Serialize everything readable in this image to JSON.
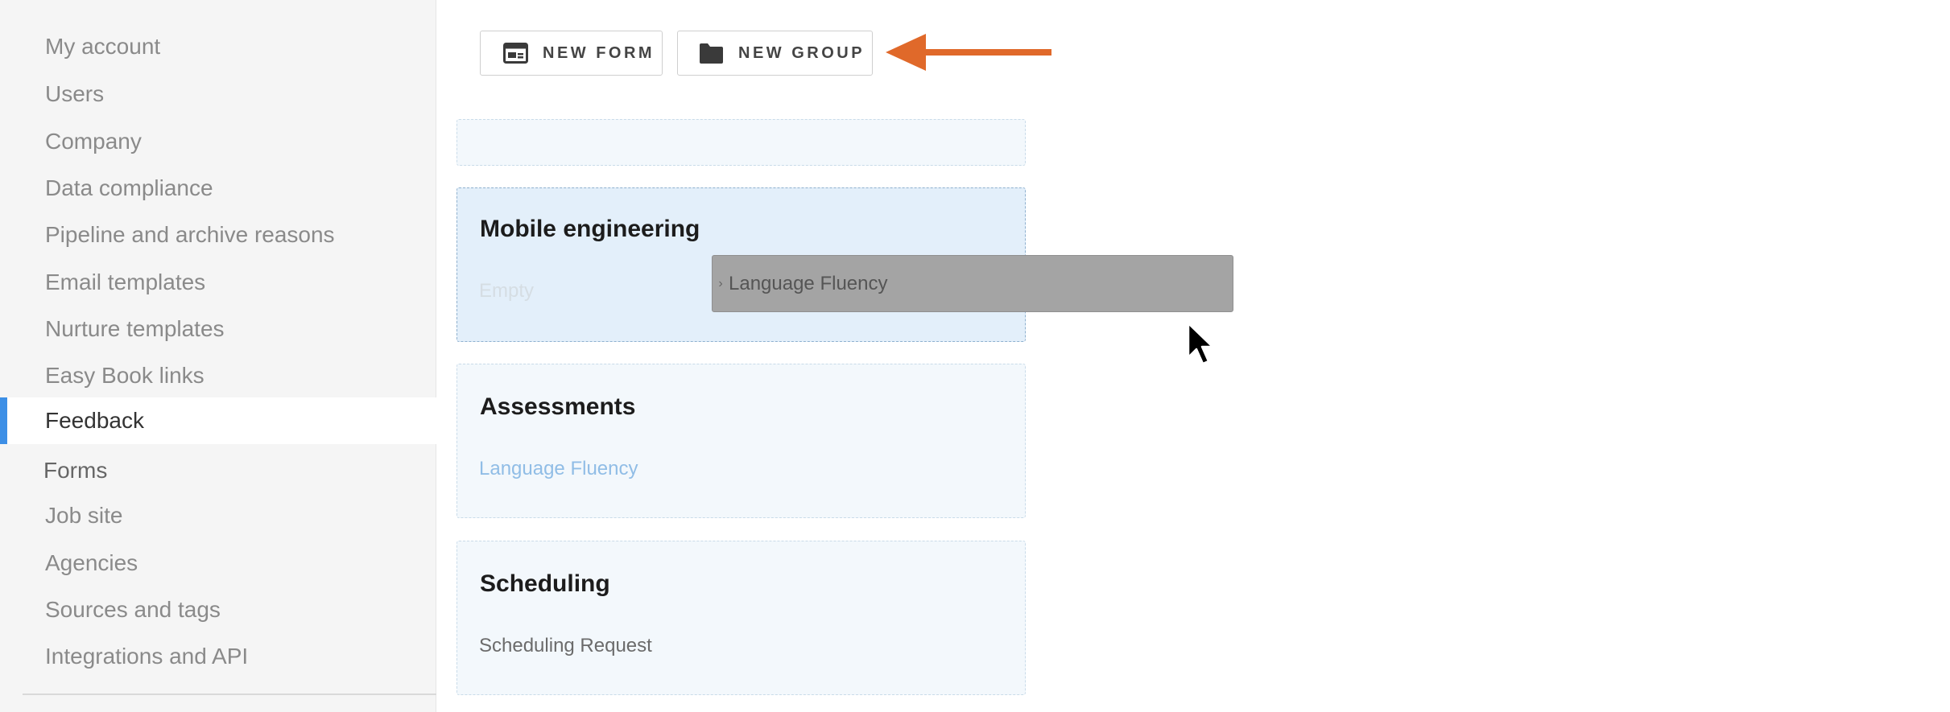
{
  "sidebar": {
    "items": [
      {
        "label": "My account"
      },
      {
        "label": "Users"
      },
      {
        "label": "Company"
      },
      {
        "label": "Data compliance"
      },
      {
        "label": "Pipeline and archive reasons"
      },
      {
        "label": "Email templates"
      },
      {
        "label": "Nurture templates"
      },
      {
        "label": "Easy Book links"
      },
      {
        "label": "Feedback",
        "active": true
      },
      {
        "label": "Forms",
        "sub": true
      },
      {
        "label": "Job site"
      },
      {
        "label": "Agencies"
      },
      {
        "label": "Sources and tags"
      },
      {
        "label": "Integrations and API"
      }
    ]
  },
  "toolbar": {
    "new_form_label": "NEW FORM",
    "new_form_icon": "form-icon",
    "new_group_label": "NEW GROUP",
    "new_group_icon": "folder-icon"
  },
  "groups": [
    {
      "title": "",
      "items": []
    },
    {
      "title": "Mobile engineering",
      "items": [
        {
          "label": "Empty",
          "style": "empty"
        }
      ],
      "highlighted": true
    },
    {
      "title": "Assessments",
      "items": [
        {
          "label": "Language Fluency",
          "style": "link"
        }
      ]
    },
    {
      "title": "Scheduling",
      "items": [
        {
          "label": "Scheduling Request",
          "style": "normal"
        }
      ]
    }
  ],
  "drag_ghost": {
    "label": "Language Fluency",
    "handle_icon": "drag-handle-icon"
  },
  "colors": {
    "accent": "#3d8fe6",
    "annotation_arrow": "#e0692a",
    "sidebar_bg": "#f5f5f5",
    "group_bg": "#f3f8fc",
    "group_highlight_bg": "#e3effa"
  }
}
